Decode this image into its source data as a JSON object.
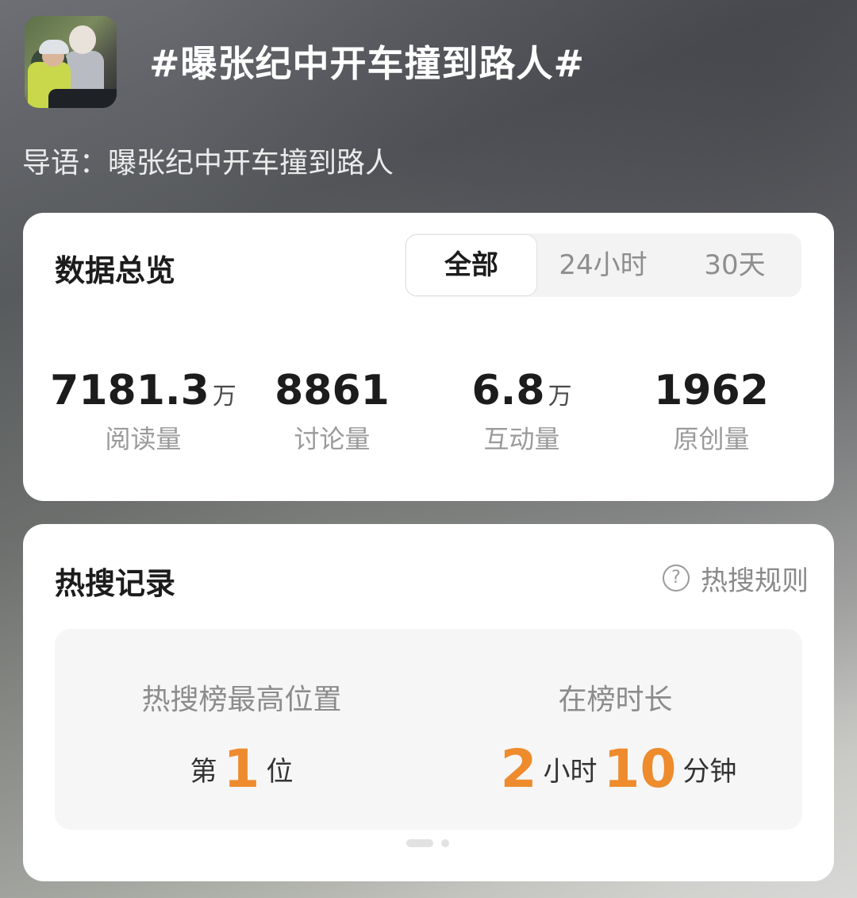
{
  "header": {
    "topic_title": "#曝张纪中开车撞到路人#",
    "lead": "导语：曝张纪中开车撞到路人"
  },
  "overview": {
    "title": "数据总览",
    "tabs": [
      {
        "label": "全部",
        "active": true
      },
      {
        "label": "24小时",
        "active": false
      },
      {
        "label": "30天",
        "active": false
      }
    ],
    "stats": [
      {
        "value": "7181.3",
        "unit": "万",
        "label": "阅读量"
      },
      {
        "value": "8861",
        "unit": "",
        "label": "讨论量"
      },
      {
        "value": "6.8",
        "unit": "万",
        "label": "互动量"
      },
      {
        "value": "1962",
        "unit": "",
        "label": "原创量"
      }
    ]
  },
  "record": {
    "title": "热搜记录",
    "rules_label": "热搜规则",
    "rules_icon": "question-circle-icon",
    "highest_position": {
      "label": "热搜榜最高位置",
      "prefix": "第",
      "value": "1",
      "suffix": "位"
    },
    "duration": {
      "label": "在榜时长",
      "hours": "2",
      "hours_unit": "小时",
      "minutes": "10",
      "minutes_unit": "分钟"
    },
    "pager": {
      "pages": 2,
      "current": 1
    }
  },
  "colors": {
    "accent_orange": "#ee8b2d",
    "card_bg": "#ffffff",
    "muted_text": "#9a9a9a"
  }
}
